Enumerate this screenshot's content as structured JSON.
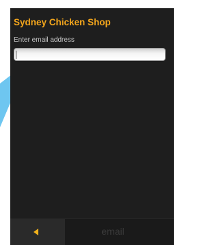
{
  "app": {
    "title": "Sydney Chicken Shop"
  },
  "form": {
    "email_label": "Enter email address",
    "email_value": "",
    "email_placeholder": ""
  },
  "toolbar": {
    "back_icon": "left-arrow-icon",
    "email_label": "email"
  },
  "colors": {
    "accent": "#f2a51c",
    "screen_background": "#1e1e1e",
    "pointer": "#6ec6f0"
  }
}
